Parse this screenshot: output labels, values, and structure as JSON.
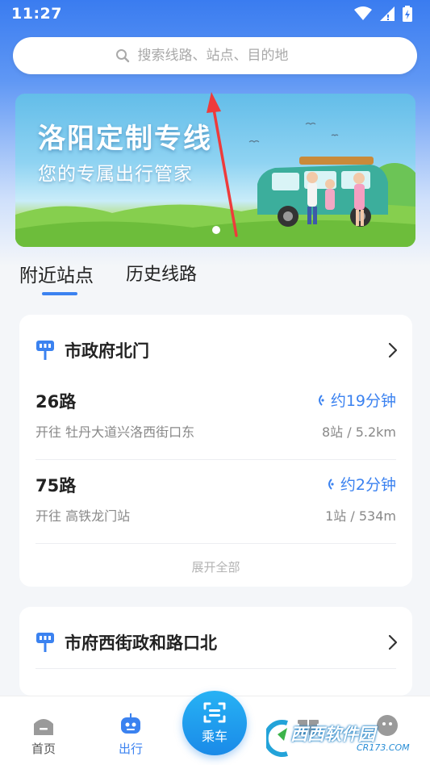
{
  "status_bar": {
    "time": "11:27"
  },
  "search": {
    "placeholder": "搜索线路、站点、目的地"
  },
  "banner": {
    "title": "洛阳定制专线",
    "subtitle": "您的专属出行管家"
  },
  "tabs": [
    {
      "label": "附近站点",
      "active": true
    },
    {
      "label": "历史线路",
      "active": false
    }
  ],
  "stations": [
    {
      "name": "市政府北门",
      "routes": [
        {
          "route": "26路",
          "direction": "开往 牡丹大道兴洛西街口东",
          "eta": "约19分钟",
          "distance": "8站 / 5.2km"
        },
        {
          "route": "75路",
          "direction": "开往 高铁龙门站",
          "eta": "约2分钟",
          "distance": "1站 / 534m"
        }
      ],
      "expand_label": "展开全部"
    },
    {
      "name": "市府西街政和路口北"
    }
  ],
  "bottom_nav": {
    "items": [
      {
        "label": "首页"
      },
      {
        "label": "出行"
      },
      {
        "label": "乘车"
      }
    ]
  },
  "watermark": {
    "text": "西西软件园",
    "url": "CR173.COM"
  },
  "colors": {
    "accent": "#3b82f0",
    "header_top": "#3a7cf0",
    "ride_button": "#1a8ae8"
  }
}
